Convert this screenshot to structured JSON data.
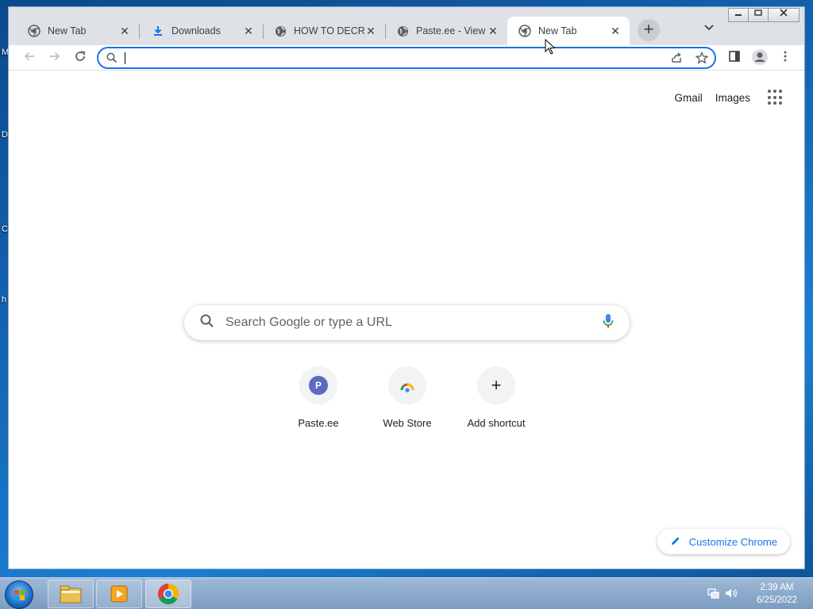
{
  "desktop": {
    "icon_letters": [
      "M",
      "D",
      "C",
      "h"
    ]
  },
  "browser": {
    "tabs": [
      {
        "title": "New Tab",
        "favicon": "chrome-icon",
        "active": false
      },
      {
        "title": "Downloads",
        "favicon": "download-icon",
        "active": false
      },
      {
        "title": "HOW TO DECRYPT",
        "favicon": "globe-icon",
        "active": false
      },
      {
        "title": "Paste.ee - View p",
        "favicon": "globe-icon",
        "active": false
      },
      {
        "title": "New Tab",
        "favicon": "chrome-icon",
        "active": true
      }
    ],
    "new_tab_label": "+",
    "omnibox": {
      "value": "",
      "placeholder": ""
    }
  },
  "ntp": {
    "top_links": {
      "gmail": "Gmail",
      "images": "Images"
    },
    "search_placeholder": "Search Google or type a URL",
    "shortcuts": [
      {
        "label": "Paste.ee",
        "icon_letter": "P"
      },
      {
        "label": "Web Store",
        "icon_letter": ""
      },
      {
        "label": "Add shortcut",
        "icon_letter": "+"
      }
    ],
    "customize_label": "Customize Chrome"
  },
  "taskbar": {
    "time": "2:39 AM",
    "date": "6/25/2022"
  },
  "colors": {
    "accent": "#1a73e8",
    "tabstrip": "#dee1e6",
    "paste_badge": "#5c6bc0"
  }
}
